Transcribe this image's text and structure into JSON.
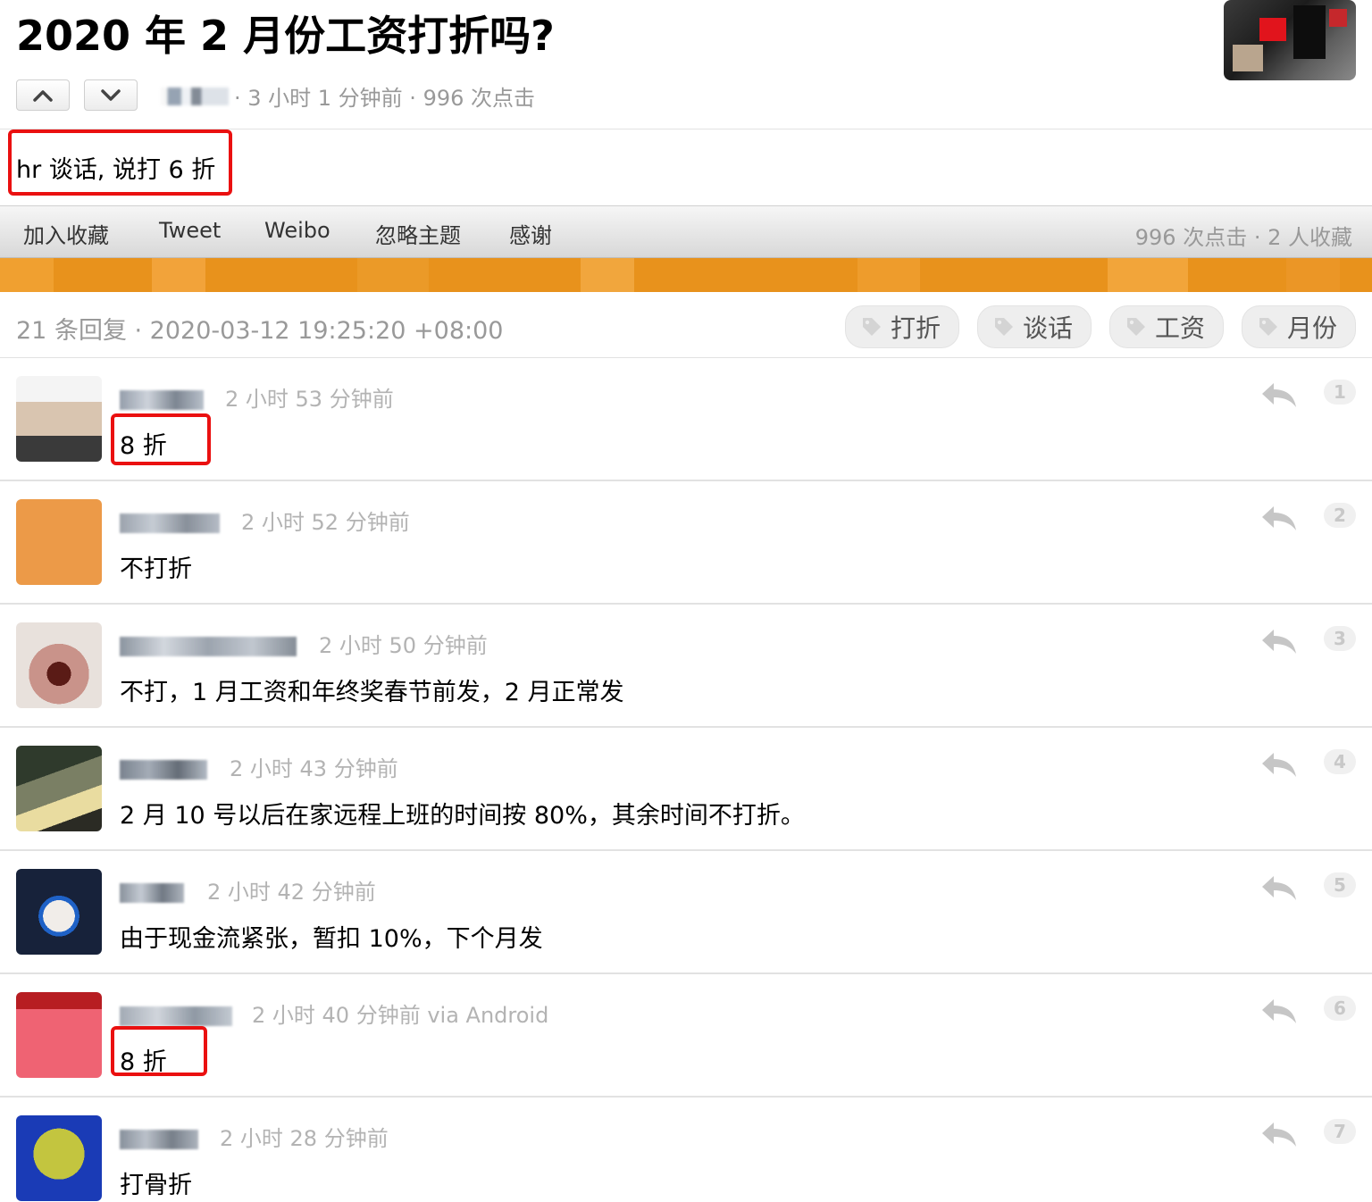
{
  "topic": {
    "title": "2020 年 2 月份工资打折吗?",
    "meta": "· 3 小时 1 分钟前 · 996 次点击",
    "content": "hr 谈话, 说打 6 折"
  },
  "toolbar": {
    "favorite": "加入收藏",
    "tweet": "Tweet",
    "weibo": "Weibo",
    "ignore": "忽略主题",
    "thanks": "感谢",
    "stats": "996 次点击 · 2 人收藏"
  },
  "replies_header": {
    "summary": "21 条回复  ·  2020-03-12 19:25:20 +08:00",
    "tags": [
      "打折",
      "谈话",
      "工资",
      "月份"
    ]
  },
  "replies": [
    {
      "time": "2 小时 53 分钟前",
      "text": "8 折",
      "floor": "1"
    },
    {
      "time": "2 小时 52 分钟前",
      "text": "不打折",
      "floor": "2"
    },
    {
      "time": "2 小时 50 分钟前",
      "text": "不打，1 月工资和年终奖春节前发，2 月正常发",
      "floor": "3"
    },
    {
      "time": "2 小时 43 分钟前",
      "text": "2 月 10 号以后在家远程上班的时间按 80%，其余时间不打折。",
      "floor": "4"
    },
    {
      "time": "2 小时 42 分钟前",
      "text": "由于现金流紧张，暂扣 10%，下个月发",
      "floor": "5"
    },
    {
      "time": "2 小时 40 分钟前 via Android",
      "text": "8 折",
      "floor": "6"
    },
    {
      "time": "2 小时 28 分钟前",
      "text": "打骨折",
      "floor": "7"
    }
  ],
  "colors": {
    "highlight_box": "#ea1010",
    "orange_strip": "#e8921c",
    "muted_text": "#999999"
  },
  "icons": {
    "vote_up": "chevron-up-icon",
    "vote_down": "chevron-down-icon",
    "tag": "tag-icon",
    "reply": "reply-arrow-icon"
  }
}
